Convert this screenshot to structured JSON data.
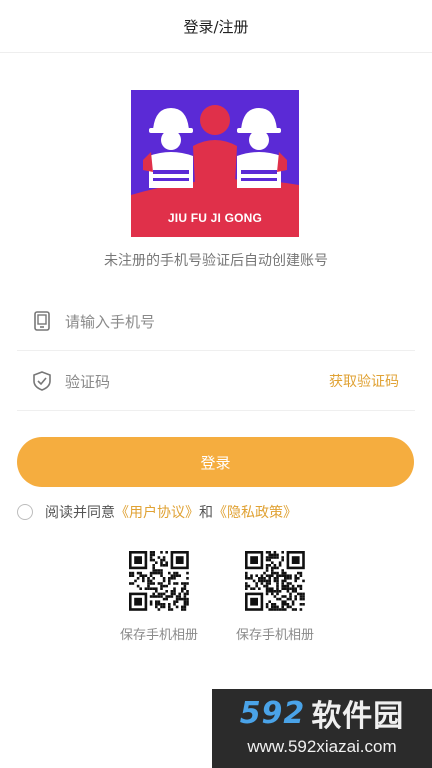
{
  "header": {
    "title": "登录/注册"
  },
  "logo": {
    "text": "JIU FU JI GONG"
  },
  "hint": "未注册的手机号验证后自动创建账号",
  "phone_field": {
    "placeholder": "请输入手机号",
    "icon": "phone-icon"
  },
  "code_field": {
    "placeholder": "验证码",
    "icon": "shield-check-icon",
    "get_code_label": "获取验证码"
  },
  "login_button": {
    "label": "登录"
  },
  "agreement": {
    "prefix": "阅读并同意",
    "user_agreement": "《用户协议》",
    "and": "和",
    "privacy_policy": "《隐私政策》"
  },
  "qr_codes": [
    {
      "label": "保存手机相册"
    },
    {
      "label": "保存手机相册"
    }
  ],
  "watermark": {
    "line1_num": "592",
    "line1_cn": "软件园",
    "line2": "www.592xiazai.com"
  },
  "colors": {
    "accent": "#f5ad3f",
    "link": "#e0a234",
    "logo_bg": "#5b2ad6",
    "logo_red": "#e0304a"
  }
}
